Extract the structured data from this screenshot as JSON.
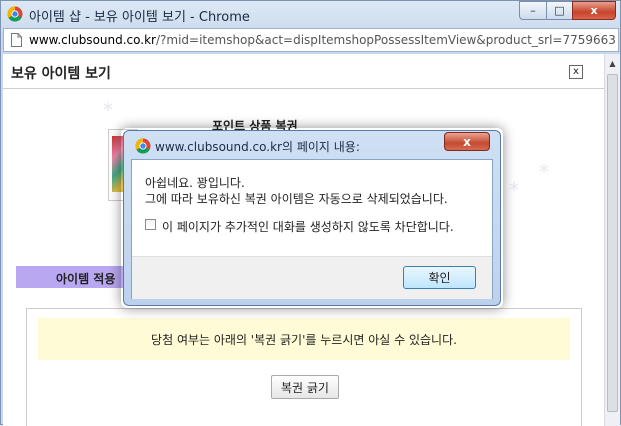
{
  "window": {
    "title": "아이템 샵 - 보유 아이템 보기 - Chrome",
    "minimize_label": "–",
    "maximize_label": "□",
    "close_label": "x"
  },
  "address_bar": {
    "domain": "www.clubsound.co.kr",
    "path": "/?mid=itemshop&act=dispItemshopPossessItemView&product_srl=7759663"
  },
  "page": {
    "title": "보유 아이템 보기",
    "close_label": "x",
    "product_name": "포인트 상품 복권",
    "apply_label": "아이템 적용",
    "notice": "당첨 여부는 아래의 '복권 긁기'를 누르시면 아실 수 있습니다.",
    "scratch_button": "복권 긁기"
  },
  "dialog": {
    "title": "www.clubsound.co.kr의 페이지 내용:",
    "message_line1": "아쉽네요. 꽝입니다.",
    "message_line2": "그에 따라 보유하신 복권 아이템은 자동으로 삭제되었습니다.",
    "suppress_label": "이 페이지가 추가적인 대화를 생성하지 않도록 차단합니다.",
    "ok_label": "확인",
    "close_label": "x"
  },
  "colors": {
    "apply_bar": "#b9a7f1",
    "notice_bg": "#fffbd6",
    "close_button": "#c6442c"
  }
}
